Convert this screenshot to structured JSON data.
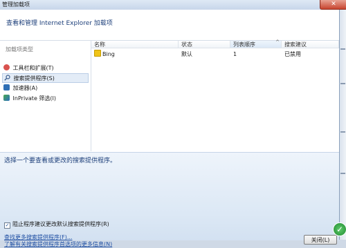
{
  "window": {
    "title": "管理加载项",
    "close_glyph": "✕"
  },
  "header": {
    "text": "查看和管理 Internet Explorer 加载项"
  },
  "sidebar": {
    "title": "加载项类型",
    "items": [
      {
        "label": "工具栏和扩展(T)",
        "icon": "toolbar-gear-icon"
      },
      {
        "label": "搜索提供程序(S)",
        "icon": "search-icon"
      },
      {
        "label": "加速器(A)",
        "icon": "accelerator-icon"
      },
      {
        "label": "InPrivate 筛选(I)",
        "icon": "inprivate-icon"
      }
    ],
    "selected_index": 1
  },
  "list": {
    "columns": [
      "名称",
      "状态",
      "列表顺序",
      "搜索建议"
    ],
    "sort_glyph": "^",
    "rows": [
      {
        "name": "Bing",
        "status": "默认",
        "order": "1",
        "suggestions": "已禁用",
        "icon": "bing-icon"
      }
    ]
  },
  "details": {
    "prompt": "选择一个要查看或更改的搜索提供程序。",
    "checkbox_label": "阻止程序建议更改默认搜索提供程序(R)",
    "checkbox_checked": true,
    "checkbox_glyph": "✓",
    "link_find_more": "查找更多搜索提供程序(F)...",
    "link_learn_more": "了解有关搜索提供程序首选项的更多信息(N)",
    "close_button": "关闭(L)"
  },
  "tray": {
    "badge_glyph": "✓"
  },
  "colors": {
    "accent_text": "#1d3f7a",
    "link": "#1f4fa3",
    "selection": "#e3ecf7"
  }
}
